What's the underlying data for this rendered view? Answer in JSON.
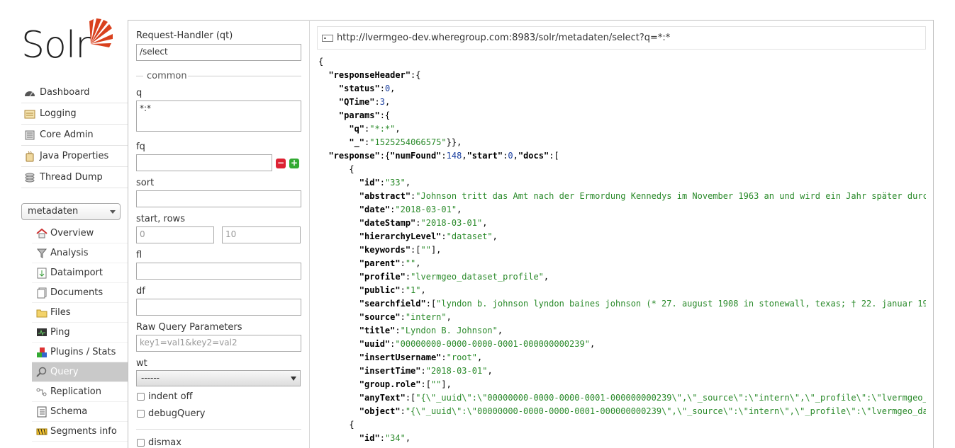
{
  "logo": {
    "text": "Solr"
  },
  "nav": [
    {
      "label": "Dashboard",
      "icon": "dashboard-icon"
    },
    {
      "label": "Logging",
      "icon": "logging-icon"
    },
    {
      "label": "Core Admin",
      "icon": "core-admin-icon"
    },
    {
      "label": "Java Properties",
      "icon": "java-icon"
    },
    {
      "label": "Thread Dump",
      "icon": "thread-dump-icon"
    }
  ],
  "core_selector": {
    "value": "metadaten"
  },
  "core_nav": [
    {
      "label": "Overview",
      "icon": "home-icon"
    },
    {
      "label": "Analysis",
      "icon": "funnel-icon"
    },
    {
      "label": "Dataimport",
      "icon": "dataimport-icon"
    },
    {
      "label": "Documents",
      "icon": "documents-icon"
    },
    {
      "label": "Files",
      "icon": "folder-icon"
    },
    {
      "label": "Ping",
      "icon": "ping-icon"
    },
    {
      "label": "Plugins / Stats",
      "icon": "plugins-icon"
    },
    {
      "label": "Query",
      "icon": "magnifier-icon",
      "active": true
    },
    {
      "label": "Replication",
      "icon": "replication-icon"
    },
    {
      "label": "Schema",
      "icon": "schema-icon"
    },
    {
      "label": "Segments info",
      "icon": "segments-icon"
    }
  ],
  "form": {
    "qt_label": "Request-Handler (qt)",
    "qt_value": "/select",
    "common_label": "common",
    "q_label": "q",
    "q_value": "*:*",
    "fq_label": "fq",
    "fq_value": "",
    "sort_label": "sort",
    "sort_value": "",
    "start_rows_label": "start, rows",
    "start_placeholder": "0",
    "rows_placeholder": "10",
    "fl_label": "fl",
    "fl_value": "",
    "df_label": "df",
    "df_value": "",
    "raw_label": "Raw Query Parameters",
    "raw_placeholder": "key1=val1&key2=val2",
    "wt_label": "wt",
    "wt_value": "------",
    "indent_label": "indent off",
    "debug_label": "debugQuery",
    "dismax_label": "dismax"
  },
  "url": "http://lvermgeo-dev.wheregroup.com:8983/solr/metadaten/select?q=*:*",
  "response_lines": [
    [
      [
        "p",
        "{"
      ]
    ],
    [
      [
        "p",
        "  "
      ],
      [
        "k",
        "\"responseHeader\""
      ],
      [
        "p",
        ":{"
      ]
    ],
    [
      [
        "p",
        "    "
      ],
      [
        "k",
        "\"status\""
      ],
      [
        "p",
        ":"
      ],
      [
        "n",
        "0"
      ],
      [
        "p",
        ","
      ]
    ],
    [
      [
        "p",
        "    "
      ],
      [
        "k",
        "\"QTime\""
      ],
      [
        "p",
        ":"
      ],
      [
        "n",
        "3"
      ],
      [
        "p",
        ","
      ]
    ],
    [
      [
        "p",
        "    "
      ],
      [
        "k",
        "\"params\""
      ],
      [
        "p",
        ":{"
      ]
    ],
    [
      [
        "p",
        "      "
      ],
      [
        "k",
        "\"q\""
      ],
      [
        "p",
        ":"
      ],
      [
        "s",
        "\"*:*\""
      ],
      [
        "p",
        ","
      ]
    ],
    [
      [
        "p",
        "      "
      ],
      [
        "k",
        "\"_\""
      ],
      [
        "p",
        ":"
      ],
      [
        "s",
        "\"1525254066575\""
      ],
      [
        "p",
        "}},"
      ]
    ],
    [
      [
        "p",
        "  "
      ],
      [
        "k",
        "\"response\""
      ],
      [
        "p",
        ":{"
      ],
      [
        "k",
        "\"numFound\""
      ],
      [
        "p",
        ":"
      ],
      [
        "n",
        "148"
      ],
      [
        "p",
        ","
      ],
      [
        "k",
        "\"start\""
      ],
      [
        "p",
        ":"
      ],
      [
        "n",
        "0"
      ],
      [
        "p",
        ","
      ],
      [
        "k",
        "\"docs\""
      ],
      [
        "p",
        ":["
      ]
    ],
    [
      [
        "p",
        "      {"
      ]
    ],
    [
      [
        "p",
        "        "
      ],
      [
        "k",
        "\"id\""
      ],
      [
        "p",
        ":"
      ],
      [
        "s",
        "\"33\""
      ],
      [
        "p",
        ","
      ]
    ],
    [
      [
        "p",
        "        "
      ],
      [
        "k",
        "\"abstract\""
      ],
      [
        "p",
        ":"
      ],
      [
        "s",
        "\"Johnson tritt das Amt nach der Ermordung Kennedys im November 1963 an und wird ein Jahr später durc"
      ]
    ],
    [
      [
        "p",
        "        "
      ],
      [
        "k",
        "\"date\""
      ],
      [
        "p",
        ":"
      ],
      [
        "s",
        "\"2018-03-01\""
      ],
      [
        "p",
        ","
      ]
    ],
    [
      [
        "p",
        "        "
      ],
      [
        "k",
        "\"dateStamp\""
      ],
      [
        "p",
        ":"
      ],
      [
        "s",
        "\"2018-03-01\""
      ],
      [
        "p",
        ","
      ]
    ],
    [
      [
        "p",
        "        "
      ],
      [
        "k",
        "\"hierarchyLevel\""
      ],
      [
        "p",
        ":"
      ],
      [
        "s",
        "\"dataset\""
      ],
      [
        "p",
        ","
      ]
    ],
    [
      [
        "p",
        "        "
      ],
      [
        "k",
        "\"keywords\""
      ],
      [
        "p",
        ":["
      ],
      [
        "s",
        "\"\""
      ],
      [
        "p",
        "],"
      ]
    ],
    [
      [
        "p",
        "        "
      ],
      [
        "k",
        "\"parent\""
      ],
      [
        "p",
        ":"
      ],
      [
        "s",
        "\"\""
      ],
      [
        "p",
        ","
      ]
    ],
    [
      [
        "p",
        "        "
      ],
      [
        "k",
        "\"profile\""
      ],
      [
        "p",
        ":"
      ],
      [
        "s",
        "\"lvermgeo_dataset_profile\""
      ],
      [
        "p",
        ","
      ]
    ],
    [
      [
        "p",
        "        "
      ],
      [
        "k",
        "\"public\""
      ],
      [
        "p",
        ":"
      ],
      [
        "s",
        "\"1\""
      ],
      [
        "p",
        ","
      ]
    ],
    [
      [
        "p",
        "        "
      ],
      [
        "k",
        "\"searchfield\""
      ],
      [
        "p",
        ":["
      ],
      [
        "s",
        "\"lyndon b. johnson lyndon baines johnson (* 27. august 1908 in stonewall, texas; † 22. januar 19"
      ]
    ],
    [
      [
        "p",
        "        "
      ],
      [
        "k",
        "\"source\""
      ],
      [
        "p",
        ":"
      ],
      [
        "s",
        "\"intern\""
      ],
      [
        "p",
        ","
      ]
    ],
    [
      [
        "p",
        "        "
      ],
      [
        "k",
        "\"title\""
      ],
      [
        "p",
        ":"
      ],
      [
        "s",
        "\"Lyndon B. Johnson\""
      ],
      [
        "p",
        ","
      ]
    ],
    [
      [
        "p",
        "        "
      ],
      [
        "k",
        "\"uuid\""
      ],
      [
        "p",
        ":"
      ],
      [
        "s",
        "\"00000000-0000-0000-0001-000000000239\""
      ],
      [
        "p",
        ","
      ]
    ],
    [
      [
        "p",
        "        "
      ],
      [
        "k",
        "\"insertUsername\""
      ],
      [
        "p",
        ":"
      ],
      [
        "s",
        "\"root\""
      ],
      [
        "p",
        ","
      ]
    ],
    [
      [
        "p",
        "        "
      ],
      [
        "k",
        "\"insertTime\""
      ],
      [
        "p",
        ":"
      ],
      [
        "s",
        "\"2018-03-01\""
      ],
      [
        "p",
        ","
      ]
    ],
    [
      [
        "p",
        "        "
      ],
      [
        "k",
        "\"group.role\""
      ],
      [
        "p",
        ":["
      ],
      [
        "s",
        "\"\""
      ],
      [
        "p",
        "],"
      ]
    ],
    [
      [
        "p",
        "        "
      ],
      [
        "k",
        "\"anyText\""
      ],
      [
        "p",
        ":["
      ],
      [
        "s",
        "\"{\\\"_uuid\\\":\\\"00000000-0000-0000-0001-000000000239\\\",\\\"_source\\\":\\\"intern\\\",\\\"_profile\\\":\\\"lvermgeo_"
      ]
    ],
    [
      [
        "p",
        "        "
      ],
      [
        "k",
        "\"object\""
      ],
      [
        "p",
        ":"
      ],
      [
        "s",
        "\"{\\\"_uuid\\\":\\\"00000000-0000-0000-0001-000000000239\\\",\\\"_source\\\":\\\"intern\\\",\\\"_profile\\\":\\\"lvermgeo_da"
      ]
    ],
    [
      [
        "p",
        "      {"
      ]
    ],
    [
      [
        "p",
        "        "
      ],
      [
        "k",
        "\"id\""
      ],
      [
        "p",
        ":"
      ],
      [
        "s",
        "\"34\""
      ],
      [
        "p",
        ","
      ]
    ]
  ]
}
